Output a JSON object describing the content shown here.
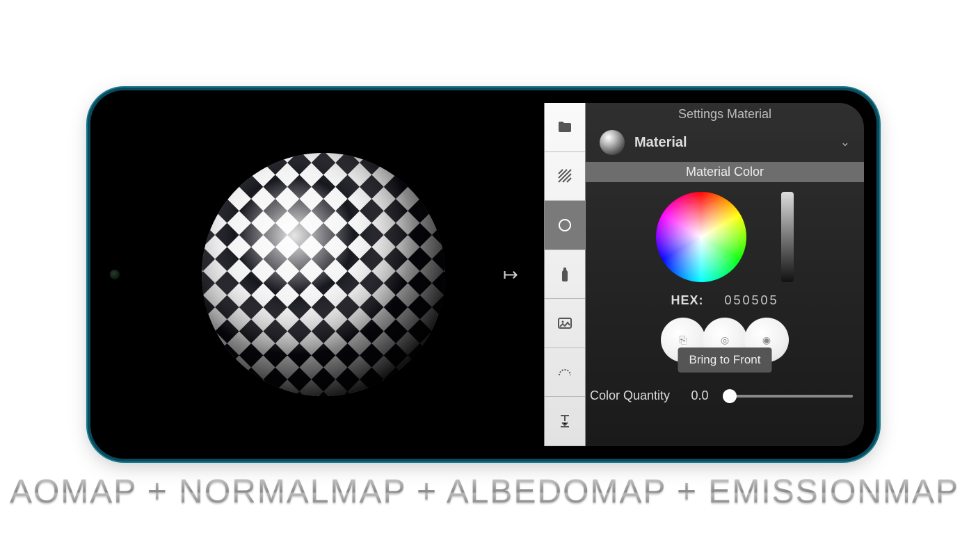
{
  "inspector": {
    "title": "Settings Material",
    "material_label": "Material",
    "section_color": "Material Color",
    "hex_label": "HEX:",
    "hex_value": "050505",
    "tooltip": "Bring to Front",
    "slider_label": "Color Quantity",
    "slider_value": "0.0"
  },
  "tools": [
    {
      "name": "folder-icon"
    },
    {
      "name": "texture-icon"
    },
    {
      "name": "circle-icon",
      "active": true
    },
    {
      "name": "bottle-icon"
    },
    {
      "name": "image-add-icon"
    },
    {
      "name": "curve-icon"
    },
    {
      "name": "align-icon"
    }
  ],
  "circle_buttons": [
    {
      "name": "copy-button",
      "glyph": "⎘"
    },
    {
      "name": "target-button",
      "glyph": "◎"
    },
    {
      "name": "eye-button",
      "glyph": "◉"
    }
  ],
  "caption": "AOMAP + NORMALMAP + ALBEDOMAP + EMISSIONMAP"
}
